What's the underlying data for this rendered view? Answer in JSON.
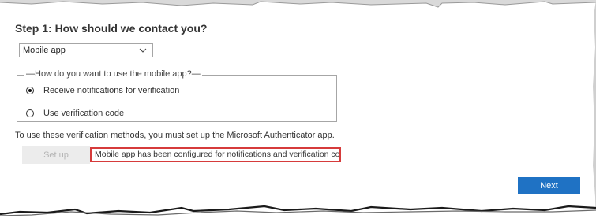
{
  "step": {
    "title": "Step 1: How should we contact you?"
  },
  "method": {
    "selected": "Mobile app",
    "chevron_icon": "chevron-down-icon"
  },
  "mobile_usage": {
    "legend": "How do you want to use the mobile app?",
    "options": [
      {
        "label": "Receive notifications for verification",
        "selected": true
      },
      {
        "label": "Use verification code",
        "selected": false
      }
    ]
  },
  "info": {
    "text": "To use these verification methods, you must set up the Microsoft Authenticator app."
  },
  "setup": {
    "label": "Set up",
    "status": "Mobile app has been configured for notifications and verification codes.",
    "status_border_color": "#d63b3b"
  },
  "footer": {
    "next_label": "Next",
    "next_color": "#1f72c4"
  }
}
